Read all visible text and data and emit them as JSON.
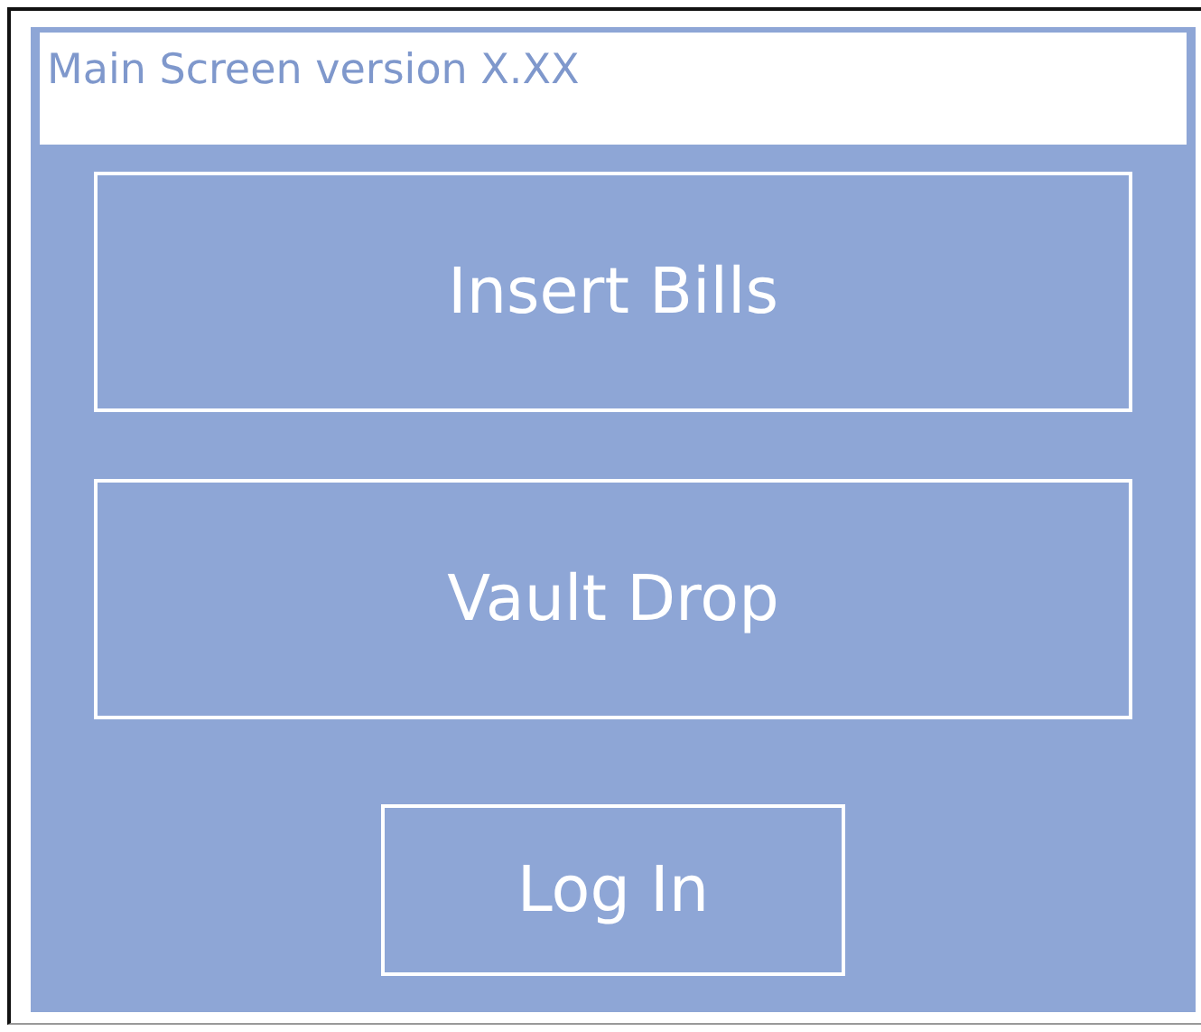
{
  "title_bar": {
    "title": "Main Screen version X.XX"
  },
  "buttons": [
    {
      "label": "Insert Bills",
      "kind": "wide"
    },
    {
      "label": "Vault Drop",
      "kind": "wide"
    },
    {
      "label": "Log In",
      "kind": "narrow"
    }
  ]
}
